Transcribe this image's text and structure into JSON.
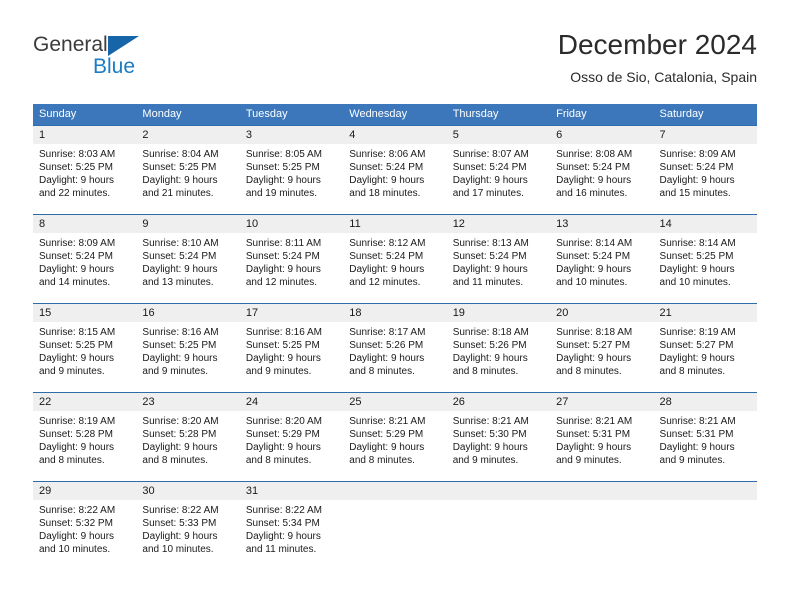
{
  "brand": {
    "name_top": "General",
    "name_bottom": "Blue",
    "accent_color": "#1a7cc4",
    "triangle_color": "#1565a8"
  },
  "header": {
    "title": "December 2024",
    "subtitle": "Osso de Sio, Catalonia, Spain"
  },
  "theme": {
    "header_row_bg": "#3b77ba",
    "week_divider": "#2f6cab",
    "day_band_bg": "#efefef"
  },
  "weekdays": [
    "Sunday",
    "Monday",
    "Tuesday",
    "Wednesday",
    "Thursday",
    "Friday",
    "Saturday"
  ],
  "weeks": [
    [
      {
        "day": "1",
        "sunrise": "Sunrise: 8:03 AM",
        "sunset": "Sunset: 5:25 PM",
        "daylight_line1": "Daylight: 9 hours",
        "daylight_line2": "and 22 minutes."
      },
      {
        "day": "2",
        "sunrise": "Sunrise: 8:04 AM",
        "sunset": "Sunset: 5:25 PM",
        "daylight_line1": "Daylight: 9 hours",
        "daylight_line2": "and 21 minutes."
      },
      {
        "day": "3",
        "sunrise": "Sunrise: 8:05 AM",
        "sunset": "Sunset: 5:25 PM",
        "daylight_line1": "Daylight: 9 hours",
        "daylight_line2": "and 19 minutes."
      },
      {
        "day": "4",
        "sunrise": "Sunrise: 8:06 AM",
        "sunset": "Sunset: 5:24 PM",
        "daylight_line1": "Daylight: 9 hours",
        "daylight_line2": "and 18 minutes."
      },
      {
        "day": "5",
        "sunrise": "Sunrise: 8:07 AM",
        "sunset": "Sunset: 5:24 PM",
        "daylight_line1": "Daylight: 9 hours",
        "daylight_line2": "and 17 minutes."
      },
      {
        "day": "6",
        "sunrise": "Sunrise: 8:08 AM",
        "sunset": "Sunset: 5:24 PM",
        "daylight_line1": "Daylight: 9 hours",
        "daylight_line2": "and 16 minutes."
      },
      {
        "day": "7",
        "sunrise": "Sunrise: 8:09 AM",
        "sunset": "Sunset: 5:24 PM",
        "daylight_line1": "Daylight: 9 hours",
        "daylight_line2": "and 15 minutes."
      }
    ],
    [
      {
        "day": "8",
        "sunrise": "Sunrise: 8:09 AM",
        "sunset": "Sunset: 5:24 PM",
        "daylight_line1": "Daylight: 9 hours",
        "daylight_line2": "and 14 minutes."
      },
      {
        "day": "9",
        "sunrise": "Sunrise: 8:10 AM",
        "sunset": "Sunset: 5:24 PM",
        "daylight_line1": "Daylight: 9 hours",
        "daylight_line2": "and 13 minutes."
      },
      {
        "day": "10",
        "sunrise": "Sunrise: 8:11 AM",
        "sunset": "Sunset: 5:24 PM",
        "daylight_line1": "Daylight: 9 hours",
        "daylight_line2": "and 12 minutes."
      },
      {
        "day": "11",
        "sunrise": "Sunrise: 8:12 AM",
        "sunset": "Sunset: 5:24 PM",
        "daylight_line1": "Daylight: 9 hours",
        "daylight_line2": "and 12 minutes."
      },
      {
        "day": "12",
        "sunrise": "Sunrise: 8:13 AM",
        "sunset": "Sunset: 5:24 PM",
        "daylight_line1": "Daylight: 9 hours",
        "daylight_line2": "and 11 minutes."
      },
      {
        "day": "13",
        "sunrise": "Sunrise: 8:14 AM",
        "sunset": "Sunset: 5:24 PM",
        "daylight_line1": "Daylight: 9 hours",
        "daylight_line2": "and 10 minutes."
      },
      {
        "day": "14",
        "sunrise": "Sunrise: 8:14 AM",
        "sunset": "Sunset: 5:25 PM",
        "daylight_line1": "Daylight: 9 hours",
        "daylight_line2": "and 10 minutes."
      }
    ],
    [
      {
        "day": "15",
        "sunrise": "Sunrise: 8:15 AM",
        "sunset": "Sunset: 5:25 PM",
        "daylight_line1": "Daylight: 9 hours",
        "daylight_line2": "and 9 minutes."
      },
      {
        "day": "16",
        "sunrise": "Sunrise: 8:16 AM",
        "sunset": "Sunset: 5:25 PM",
        "daylight_line1": "Daylight: 9 hours",
        "daylight_line2": "and 9 minutes."
      },
      {
        "day": "17",
        "sunrise": "Sunrise: 8:16 AM",
        "sunset": "Sunset: 5:25 PM",
        "daylight_line1": "Daylight: 9 hours",
        "daylight_line2": "and 9 minutes."
      },
      {
        "day": "18",
        "sunrise": "Sunrise: 8:17 AM",
        "sunset": "Sunset: 5:26 PM",
        "daylight_line1": "Daylight: 9 hours",
        "daylight_line2": "and 8 minutes."
      },
      {
        "day": "19",
        "sunrise": "Sunrise: 8:18 AM",
        "sunset": "Sunset: 5:26 PM",
        "daylight_line1": "Daylight: 9 hours",
        "daylight_line2": "and 8 minutes."
      },
      {
        "day": "20",
        "sunrise": "Sunrise: 8:18 AM",
        "sunset": "Sunset: 5:27 PM",
        "daylight_line1": "Daylight: 9 hours",
        "daylight_line2": "and 8 minutes."
      },
      {
        "day": "21",
        "sunrise": "Sunrise: 8:19 AM",
        "sunset": "Sunset: 5:27 PM",
        "daylight_line1": "Daylight: 9 hours",
        "daylight_line2": "and 8 minutes."
      }
    ],
    [
      {
        "day": "22",
        "sunrise": "Sunrise: 8:19 AM",
        "sunset": "Sunset: 5:28 PM",
        "daylight_line1": "Daylight: 9 hours",
        "daylight_line2": "and 8 minutes."
      },
      {
        "day": "23",
        "sunrise": "Sunrise: 8:20 AM",
        "sunset": "Sunset: 5:28 PM",
        "daylight_line1": "Daylight: 9 hours",
        "daylight_line2": "and 8 minutes."
      },
      {
        "day": "24",
        "sunrise": "Sunrise: 8:20 AM",
        "sunset": "Sunset: 5:29 PM",
        "daylight_line1": "Daylight: 9 hours",
        "daylight_line2": "and 8 minutes."
      },
      {
        "day": "25",
        "sunrise": "Sunrise: 8:21 AM",
        "sunset": "Sunset: 5:29 PM",
        "daylight_line1": "Daylight: 9 hours",
        "daylight_line2": "and 8 minutes."
      },
      {
        "day": "26",
        "sunrise": "Sunrise: 8:21 AM",
        "sunset": "Sunset: 5:30 PM",
        "daylight_line1": "Daylight: 9 hours",
        "daylight_line2": "and 9 minutes."
      },
      {
        "day": "27",
        "sunrise": "Sunrise: 8:21 AM",
        "sunset": "Sunset: 5:31 PM",
        "daylight_line1": "Daylight: 9 hours",
        "daylight_line2": "and 9 minutes."
      },
      {
        "day": "28",
        "sunrise": "Sunrise: 8:21 AM",
        "sunset": "Sunset: 5:31 PM",
        "daylight_line1": "Daylight: 9 hours",
        "daylight_line2": "and 9 minutes."
      }
    ],
    [
      {
        "day": "29",
        "sunrise": "Sunrise: 8:22 AM",
        "sunset": "Sunset: 5:32 PM",
        "daylight_line1": "Daylight: 9 hours",
        "daylight_line2": "and 10 minutes."
      },
      {
        "day": "30",
        "sunrise": "Sunrise: 8:22 AM",
        "sunset": "Sunset: 5:33 PM",
        "daylight_line1": "Daylight: 9 hours",
        "daylight_line2": "and 10 minutes."
      },
      {
        "day": "31",
        "sunrise": "Sunrise: 8:22 AM",
        "sunset": "Sunset: 5:34 PM",
        "daylight_line1": "Daylight: 9 hours",
        "daylight_line2": "and 11 minutes."
      },
      {
        "day": "",
        "sunrise": "",
        "sunset": "",
        "daylight_line1": "",
        "daylight_line2": ""
      },
      {
        "day": "",
        "sunrise": "",
        "sunset": "",
        "daylight_line1": "",
        "daylight_line2": ""
      },
      {
        "day": "",
        "sunrise": "",
        "sunset": "",
        "daylight_line1": "",
        "daylight_line2": ""
      },
      {
        "day": "",
        "sunrise": "",
        "sunset": "",
        "daylight_line1": "",
        "daylight_line2": ""
      }
    ]
  ]
}
